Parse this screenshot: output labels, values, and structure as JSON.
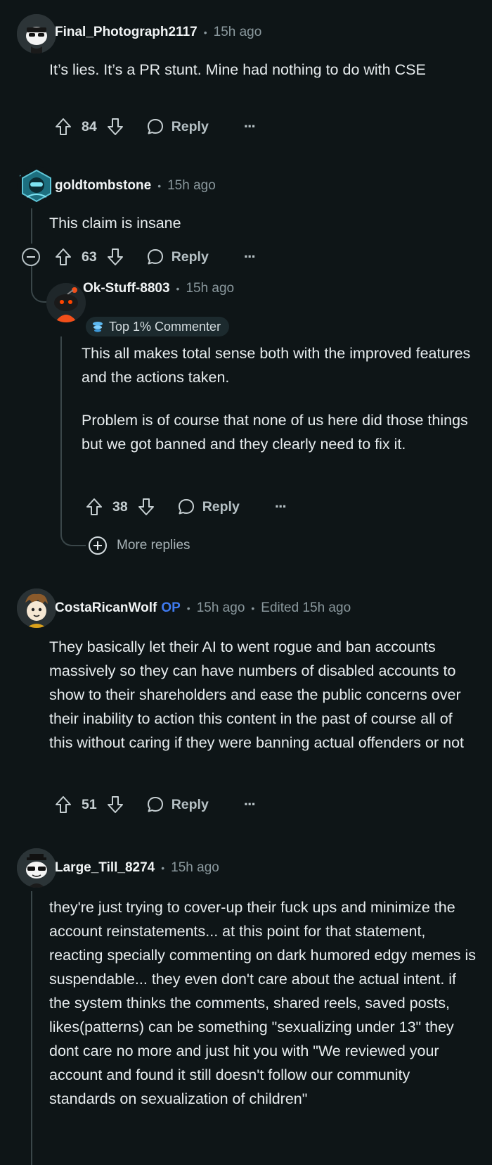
{
  "comments": [
    {
      "username": "Final_Photograph2117",
      "time": "15h ago",
      "body": [
        "It’s lies. It’s a PR stunt. Mine had nothing to do with CSE"
      ],
      "score": "84",
      "reply_label": "Reply",
      "more_label": "···"
    },
    {
      "username": "goldtombstone",
      "time": "15h ago",
      "body": [
        "This claim is insane"
      ],
      "score": "63",
      "reply_label": "Reply",
      "more_label": "···",
      "reply": {
        "username": "Ok-Stuff-8803",
        "time": "15h ago",
        "badge": "Top 1% Commenter",
        "body": [
          "This all makes total sense both with the improved features and the actions taken.",
          "Problem is of course that none of us here did those things but we got banned and they clearly need to fix it."
        ],
        "score": "38",
        "reply_label": "Reply",
        "more_label": "···"
      },
      "more_replies_label": "More replies"
    },
    {
      "username": "CostaRicanWolf",
      "op_label": "OP",
      "time": "15h ago",
      "edited": "Edited 15h ago",
      "body": [
        "They basically let their AI to went rogue and ban accounts massively so they can have numbers of disabled accounts to show to their shareholders and ease the public concerns over their inability to action this content in the past of course all of this without caring if they were banning actual offenders or not"
      ],
      "score": "51",
      "reply_label": "Reply",
      "more_label": "···"
    },
    {
      "username": "Large_Till_8274",
      "time": "15h ago",
      "body": [
        "they're just trying to cover-up their fuck ups and minimize the account reinstatements... at this point for that statement, reacting specially commenting on dark humored edgy memes is suspendable... they even don't care about the actual intent. if the system thinks the comments, shared reels, saved posts, likes(patterns) can be something \"sexualizing under 13\" they dont care no more and just hit you with \"We reviewed your account and found it still doesn't follow our community standards on sexualization of children\""
      ]
    }
  ],
  "colors": {
    "background": "#0e1517",
    "op": "#3f7bf0",
    "meta": "#8a989d",
    "thread_line": "#3a4649"
  }
}
